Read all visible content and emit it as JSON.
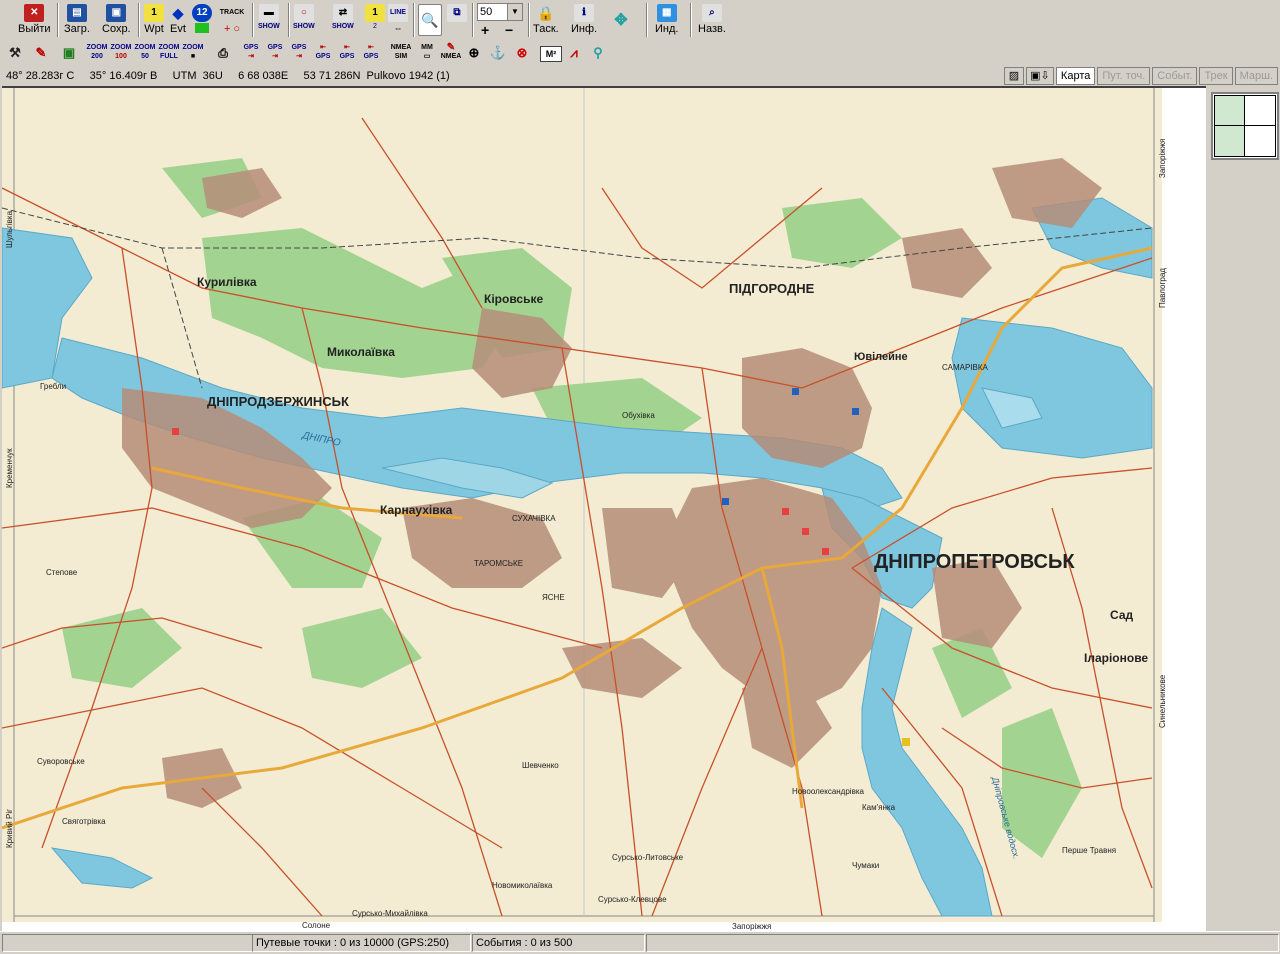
{
  "toolbar": {
    "exit_label": "Выйти",
    "load_label": "Загр.",
    "save_label": "Сохр.",
    "wpt_label": "Wpt",
    "evt_label": "Evt",
    "track_label": "TRACK",
    "show_label": "SHOW",
    "line_label": "LINE",
    "zoom_value": "50",
    "task_label": "Таск.",
    "info_label": "Инф.",
    "ind_label": "Инд.",
    "name_label": "Назв."
  },
  "zoom_buttons": [
    {
      "top": "ZOOM",
      "bottom": "200"
    },
    {
      "top": "ZOOM",
      "bottom": "100"
    },
    {
      "top": "ZOOM",
      "bottom": "50"
    },
    {
      "top": "ZOOM",
      "bottom": "FULL"
    },
    {
      "top": "ZOOM",
      "bottom": ""
    }
  ],
  "gps_buttons": [
    "GPS",
    "GPS",
    "GPS",
    "GPS",
    "GPS",
    "GPS"
  ],
  "nmea_sim": "NMEA SIM",
  "mm_label": "MM",
  "nmea_label": "NMEA",
  "coords": {
    "lat": "48° 28.283г С",
    "lon": "35° 16.409г В",
    "utm_label": "UTM",
    "zone": "36U",
    "easting": "6 68 038E",
    "northing": "53 71 286N",
    "datum": "Pulkovo 1942 (1)"
  },
  "tabs": [
    {
      "label": "Карта",
      "active": true
    },
    {
      "label": "Пут. точ.",
      "active": false
    },
    {
      "label": "Событ.",
      "active": false
    },
    {
      "label": "Трек",
      "active": false
    },
    {
      "label": "Марш.",
      "active": false
    }
  ],
  "status": {
    "waypoints": "Путевые точки : 0 из 10000  (GPS:250)",
    "events": "События : 0 из 500"
  },
  "map": {
    "city_major": "ДНІПРОПЕТРОВСЬК",
    "city_2": "ДНІПРОДЗЕРЖИНСЬК",
    "city_3": "ПІДГОРОДНЕ",
    "kurylivka": "Курилівка",
    "mykolaivka": "Миколаївка",
    "kirovske": "Кіровське",
    "karnaukhivka": "Карнаухівка",
    "yuvileine": "Ювілейне",
    "sad": "Сад",
    "ilarionove": "Іларіонове",
    "dnipro": "ДНІПРО",
    "samarivka": "САМАРІВКА",
    "hrebli": "Гребли",
    "sukhachivka": "СУХАЧІВКА",
    "taromske": "ТАРОМСЬКЕ",
    "yasne": "ЯСНЕ",
    "sviatohirivka": "Свяготрівка",
    "shevchenko": "Шевченко",
    "novooleksandrivka": "Новоолександрівка",
    "sursko_lytovske": "Сурсько-Литовське",
    "sursko_klevtsove": "Сурсько-Клевцове",
    "novomykolaivka": "Новомиколаївка",
    "soldatske": "Солоне",
    "suvorovske": "Суворовське",
    "zaporizhzhia": "Запоріжжя",
    "pavlohrad": "Павлоград",
    "krasnohrad": "Кременчук",
    "shulhivka": "Шульгівка",
    "synelnykove": "Синельникове",
    "zaporizhzhia_r": "Запоріжжя",
    "kryvyi_rih": "Кривий Ріг",
    "podgorodnie_lbl": "Степове",
    "obukhivka": "Обухівка",
    "pershe_travnia": "Перше Травня",
    "chumaky": "Чумаки",
    "kamka": "Кам'янка",
    "dnipro_lake": "Дніпровське водосх.",
    "mayak": "Сурсько-Михайлівка"
  },
  "colors": {
    "map_bg": "#f3ecd2",
    "water": "#7fc7df",
    "forest": "#9fcf8f",
    "urban": "#b58d78",
    "road": "#c8502a",
    "highway": "#e8a83a"
  }
}
